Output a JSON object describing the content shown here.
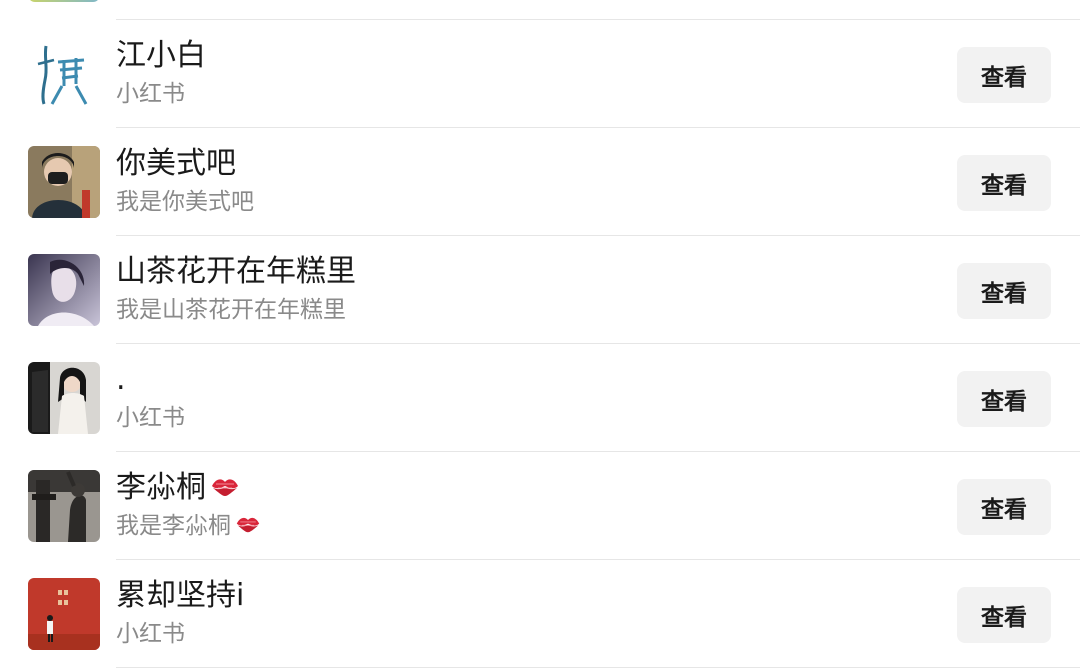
{
  "followers": [
    {
      "name": "江小白",
      "subtitle": "小红书",
      "avatar": "calligraphy-logo-avatar",
      "action_label": "查看"
    },
    {
      "name": "你美式吧",
      "subtitle": "我是你美式吧",
      "avatar": "person-with-mask-avatar",
      "action_label": "查看"
    },
    {
      "name": "山茶花开在年糕里",
      "subtitle": "我是山茶花开在年糕里",
      "avatar": "portrait-avatar",
      "action_label": "查看"
    },
    {
      "name": ".",
      "subtitle": "小红书",
      "avatar": "woman-photo-avatar",
      "action_label": "查看"
    },
    {
      "name": "李尛桐",
      "name_emoji": "💋",
      "subtitle": "我是李尛桐",
      "subtitle_emoji": "💋",
      "avatar": "dark-photo-avatar",
      "action_label": "查看"
    },
    {
      "name": "累却坚持i",
      "subtitle": "小红书",
      "avatar": "red-wall-avatar",
      "action_label": "查看"
    }
  ],
  "colors": {
    "name_text": "#1a1a1a",
    "subtitle_text": "#8a8a8a",
    "button_bg": "#f2f2f2",
    "divider": "#e6e6e6"
  }
}
